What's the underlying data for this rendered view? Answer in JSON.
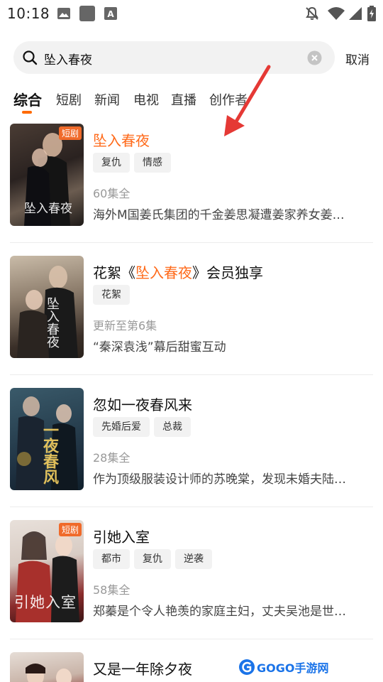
{
  "status_bar": {
    "time": "10:18",
    "left_icons": [
      "image-icon",
      "square-app-icon",
      "font-app-icon"
    ],
    "right_icons": [
      "mute-icon",
      "wifi-icon",
      "signal-icon",
      "battery-icon"
    ]
  },
  "search": {
    "query": "坠入春夜",
    "cancel_label": "取消"
  },
  "tabs": [
    {
      "label": "综合",
      "active": true
    },
    {
      "label": "短剧"
    },
    {
      "label": "新闻"
    },
    {
      "label": "电视"
    },
    {
      "label": "直播"
    },
    {
      "label": "创作者"
    }
  ],
  "results": [
    {
      "badge": "短剧",
      "cover_text": "坠入春夜",
      "title": "坠入春夜",
      "tags": [
        "复仇",
        "情感"
      ],
      "meta": "60集全",
      "desc": "海外M国姜氏集团的千金姜思凝遭姜家养女姜…"
    },
    {
      "title_prefix": "花絮《",
      "title_highlight": "坠入春夜",
      "title_suffix": "》会员独享",
      "cover_text": "坠入春夜",
      "tags": [
        "花絮"
      ],
      "meta": "更新至第6集",
      "desc": "“秦深袁浅”幕后甜蜜互动"
    },
    {
      "cover_text": "一夜春风",
      "title": "忽如一夜春风来",
      "tags": [
        "先婚后爱",
        "总裁"
      ],
      "meta": "28集全",
      "desc": "作为顶级服装设计师的苏晚棠，发现未婚夫陆…"
    },
    {
      "badge": "短剧",
      "cover_text": "引她入室",
      "title": "引她入室",
      "tags": [
        "都市",
        "复仇",
        "逆袭"
      ],
      "meta": "58集全",
      "desc": "郑蓁是个令人艳羡的家庭主妇，丈夫吴池是世…"
    },
    {
      "title": "又是一年除夕夜"
    }
  ],
  "watermark": "GOGO手游网",
  "colors": {
    "accent": "#ff6a1a",
    "badge": "#f06a2a",
    "arrow": "#e53935"
  }
}
